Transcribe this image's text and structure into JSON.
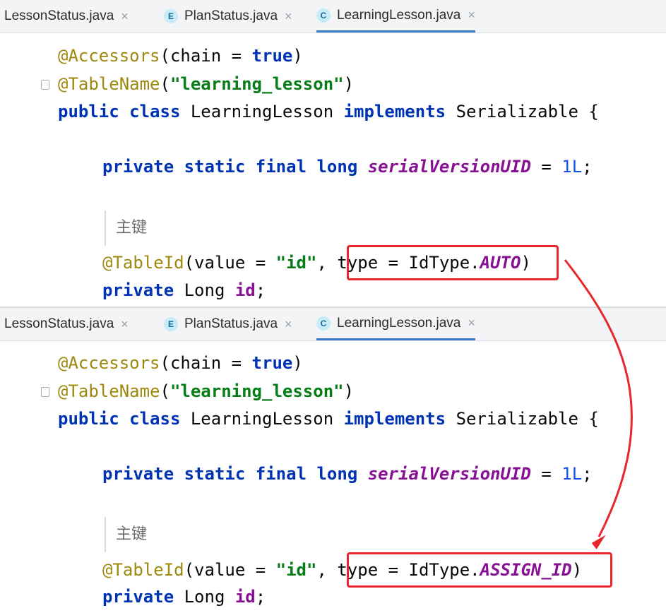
{
  "tabs": [
    {
      "label": "LessonStatus.java",
      "icon": "none"
    },
    {
      "label": "PlanStatus.java",
      "icon": "enum-icon",
      "icon_letter": "E"
    },
    {
      "label": "LearningLesson.java",
      "icon": "class-icon",
      "icon_letter": "C",
      "active": true
    }
  ],
  "close_glyph": "×",
  "top_panel": {
    "lines": {
      "accessors_ann": "@Accessors",
      "accessors_open": "(chain = ",
      "accessors_true": "true",
      "accessors_close": ")",
      "tablename_ann": "@TableName",
      "tablename_open": "(",
      "tablename_str": "\"learning_lesson\"",
      "tablename_close": ")",
      "kw_public": "public",
      "kw_class": "class",
      "class_name": "LearningLesson",
      "kw_implements": "implements",
      "iface": "Serializable {",
      "kw_private": "private",
      "kw_static": "static",
      "kw_final": "final",
      "kw_long": "long",
      "field_uid": "serialVersionUID",
      "eq": " = ",
      "num_1l": "1L",
      "semi": ";",
      "comment": "主键",
      "tableid_ann": "@TableId",
      "tableid_open": "(value = ",
      "tableid_str": "\"id\"",
      "tableid_comma": ", ",
      "type_part": "type = IdType.",
      "id_type": "AUTO",
      "tableid_close": ")",
      "type_Long": "Long ",
      "field_id": "id"
    }
  },
  "bottom_panel": {
    "id_type": "ASSIGN_ID"
  },
  "colors": {
    "highlight": "#e8262b",
    "keyword": "#0033b3",
    "annotation": "#9e880d",
    "string": "#067d17",
    "field": "#871094"
  }
}
